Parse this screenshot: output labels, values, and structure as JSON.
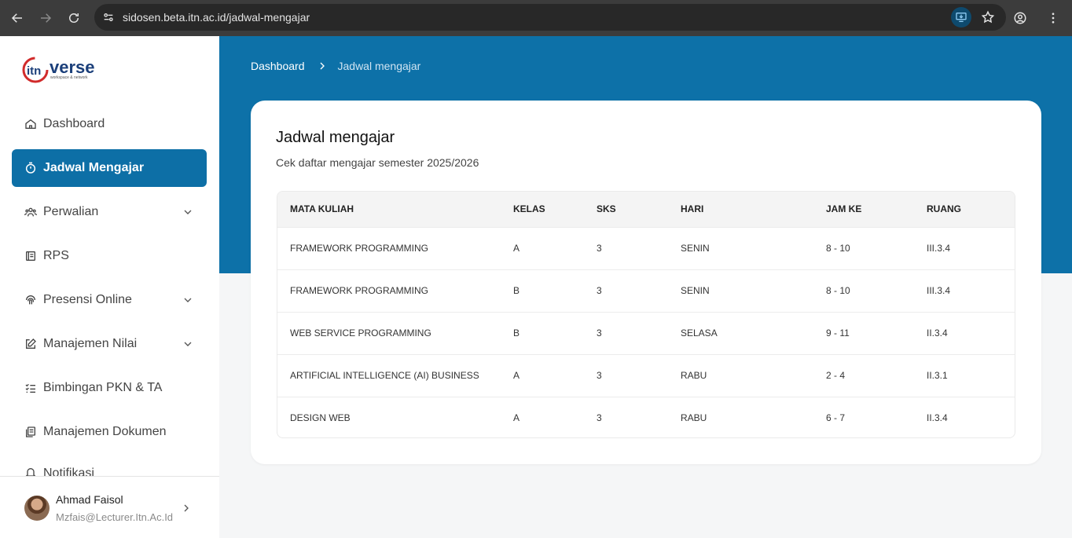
{
  "browser": {
    "url": "sidosen.beta.itn.ac.id/jadwal-mengajar"
  },
  "sidebar": {
    "logo_text": "verse",
    "logo_sub": "workspace & network",
    "items": [
      {
        "label": "Dashboard"
      },
      {
        "label": "Jadwal Mengajar"
      },
      {
        "label": "Perwalian"
      },
      {
        "label": "RPS"
      },
      {
        "label": "Presensi Online"
      },
      {
        "label": "Manajemen Nilai"
      },
      {
        "label": "Bimbingan PKN & TA"
      },
      {
        "label": "Manajemen Dokumen"
      },
      {
        "label": "Notifikasi"
      }
    ],
    "user": {
      "name": "Ahmad Faisol",
      "email": "Mzfais@Lecturer.Itn.Ac.Id"
    }
  },
  "breadcrumb": {
    "home": "Dashboard",
    "current": "Jadwal mengajar"
  },
  "card": {
    "title": "Jadwal mengajar",
    "subtitle": "Cek daftar mengajar semester 2025/2026"
  },
  "table": {
    "headers": [
      "MATA KULIAH",
      "KELAS",
      "SKS",
      "HARI",
      "JAM KE",
      "RUANG"
    ],
    "rows": [
      [
        "FRAMEWORK PROGRAMMING",
        "A",
        "3",
        "SENIN",
        "8 - 10",
        "III.3.4"
      ],
      [
        "FRAMEWORK PROGRAMMING",
        "B",
        "3",
        "SENIN",
        "8 - 10",
        "III.3.4"
      ],
      [
        "WEB SERVICE PROGRAMMING",
        "B",
        "3",
        "SELASA",
        "9 - 11",
        "II.3.4"
      ],
      [
        "ARTIFICIAL INTELLIGENCE (AI) BUSINESS",
        "A",
        "3",
        "RABU",
        "2 - 4",
        "II.3.1"
      ],
      [
        "DESIGN WEB",
        "A",
        "3",
        "RABU",
        "6 - 7",
        "II.3.4"
      ]
    ]
  },
  "colors": {
    "brand": "#0d71a8",
    "active_item": "#0d6fa6"
  }
}
